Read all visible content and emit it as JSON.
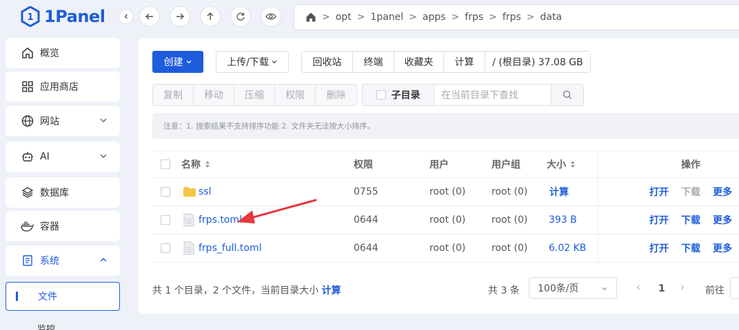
{
  "brand": {
    "name": "1Panel",
    "mark": "1"
  },
  "sidebar": {
    "items": [
      {
        "label": "概览",
        "icon": "home-icon"
      },
      {
        "label": "应用商店",
        "icon": "grid-icon"
      },
      {
        "label": "网站",
        "icon": "globe-icon"
      },
      {
        "label": "AI",
        "icon": "robot-icon"
      },
      {
        "label": "数据库",
        "icon": "layers-icon"
      },
      {
        "label": "容器",
        "icon": "docker-icon"
      },
      {
        "label": "系统",
        "icon": "system-icon"
      }
    ],
    "active_sub": "文件",
    "next_sub": "监控"
  },
  "breadcrumb": [
    "opt",
    "1panel",
    "apps",
    "frps",
    "frps",
    "data"
  ],
  "toolbar": {
    "create": "创建",
    "upload": "上传/下载",
    "recycle": "回收站",
    "terminal": "终端",
    "favorites": "收藏夹",
    "calculate": "计算",
    "disk": "/ (根目录) 37.08 GB"
  },
  "actions": [
    "复制",
    "移动",
    "压缩",
    "权限",
    "删除"
  ],
  "search": {
    "subdir_label": "子目录",
    "placeholder": "在当前目录下查找"
  },
  "notice": "注意：1. 搜索结果不支持排序功能 2. 文件夹无法按大小排序。",
  "table": {
    "headers": {
      "name": "名称",
      "perm": "权限",
      "user": "用户",
      "group": "用户组",
      "size": "大小",
      "ops": "操作"
    },
    "rows": [
      {
        "name": "ssl",
        "type": "folder",
        "perm": "0755",
        "user": "root (0)",
        "group": "root (0)",
        "size": "计算",
        "open": "打开",
        "download": "下载",
        "more": "更多"
      },
      {
        "name": "frps.toml",
        "type": "file",
        "perm": "0644",
        "user": "root (0)",
        "group": "root (0)",
        "size": "393 B",
        "open": "打开",
        "download": "下载",
        "more": "更多"
      },
      {
        "name": "frps_full.toml",
        "type": "file",
        "perm": "0644",
        "user": "root (0)",
        "group": "root (0)",
        "size": "6.02 KB",
        "open": "打开",
        "download": "下载",
        "more": "更多"
      }
    ]
  },
  "footer": {
    "summary": "共 1 个目录，2 个文件，当前目录大小",
    "calc": "计算",
    "total": "共 3 条",
    "page_size": "100条/页",
    "current_page": "1",
    "goto": "前往"
  },
  "colors": {
    "accent": "#1d5cdc",
    "annotation": "#e8363d",
    "folder": "#f7c444"
  }
}
